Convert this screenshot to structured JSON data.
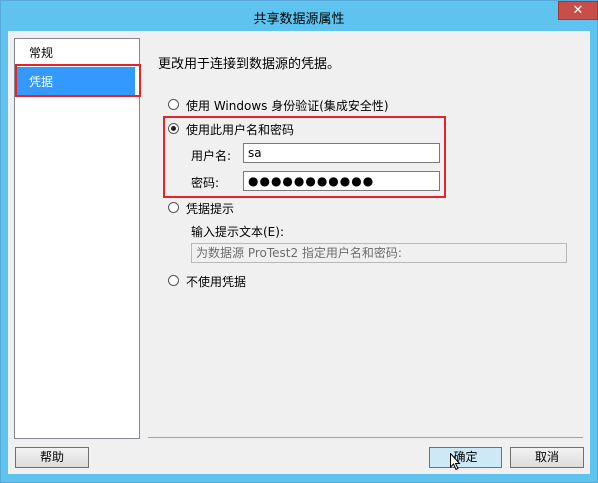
{
  "window": {
    "title": "共享数据源属性",
    "close_label": "✕"
  },
  "nav": {
    "items": [
      {
        "label": "常规",
        "selected": false
      },
      {
        "label": "凭据",
        "selected": true
      }
    ]
  },
  "main": {
    "heading": "更改用于连接到数据源的凭据。",
    "options": [
      {
        "label": "使用 Windows 身份验证(集成安全性)",
        "checked": false
      },
      {
        "label": "使用此用户名和密码",
        "checked": true
      },
      {
        "label": "凭据提示",
        "checked": false
      },
      {
        "label": "不使用凭据",
        "checked": false
      }
    ],
    "username_label": "用户名:",
    "username_value": "sa",
    "password_label": "密码:",
    "password_value": "●●●●●●●●●●●",
    "prompt_label": "输入提示文本(E):",
    "prompt_value": "为数据源 ProTest2 指定用户名和密码:"
  },
  "footer": {
    "help_label": "帮助",
    "ok_label": "确定",
    "cancel_label": "取消"
  },
  "colors": {
    "accent_selection": "#3399ff",
    "highlight_box": "#e4242b",
    "titlebar": "#5ec3ee",
    "close_button": "#c74f47"
  }
}
